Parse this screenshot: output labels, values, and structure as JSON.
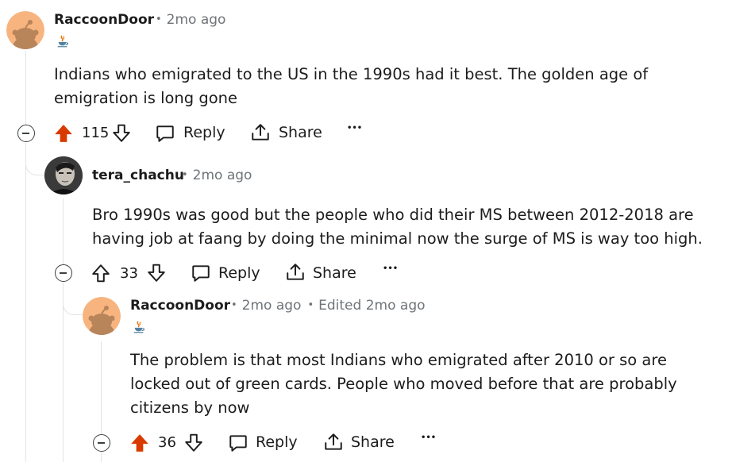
{
  "comments": [
    {
      "username": "RaccoonDoor",
      "timestamp": "2mo ago",
      "edited": "",
      "flair_icon": "java-cup-icon",
      "body": "Indians who emigrated to the US in the 1990s had it best. The golden age of emigration is long gone",
      "score": "115",
      "upvoted": true,
      "reply_label": "Reply",
      "share_label": "Share",
      "more_label": "•••"
    },
    {
      "username": "tera_chachu",
      "timestamp": "2mo ago",
      "edited": "",
      "body": "Bro 1990s was good but the people who did their MS between 2012-2018 are having job at faang by doing the minimal now the surge of MS is way too high.",
      "score": "33",
      "upvoted": false,
      "reply_label": "Reply",
      "share_label": "Share",
      "more_label": "•••"
    },
    {
      "username": "RaccoonDoor",
      "timestamp": "2mo ago",
      "edited": "Edited 2mo ago",
      "flair_icon": "java-cup-icon",
      "body": "The problem is that most Indians who emigrated after 2010 or so are locked out of green cards. People who moved before that are probably citizens by now",
      "score": "36",
      "upvoted": true,
      "reply_label": "Reply",
      "share_label": "Share",
      "more_label": "•••"
    }
  ],
  "colors": {
    "upvote_active": "#d93a00",
    "meta_gray": "#6f7478",
    "thread_line": "#e0e3e6",
    "avatar_orange": "#f7b47f"
  }
}
